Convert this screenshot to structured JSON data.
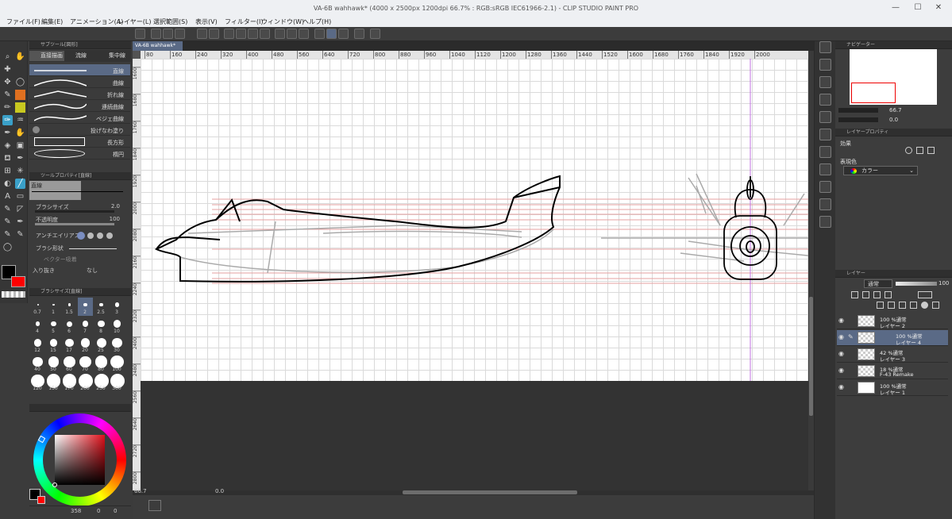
{
  "window": {
    "title": "VA-6B wahhawk* (4000 x 2500px 1200dpi 66.7% : RGB:sRGB IEC61966-2.1) - CLIP STUDIO PAINT PRO",
    "min_glyph": "—",
    "max_glyph": "☐",
    "close_glyph": "✕"
  },
  "menu": [
    "ファイル(F)",
    "編集(E)",
    "アニメーション(A)",
    "レイヤー(L)",
    "選択範囲(S)",
    "表示(V)",
    "フィルター(I)",
    "ウィンドウ(W)",
    "ヘルプ(H)"
  ],
  "document_tab": {
    "label": "VA-6B wahhawk*",
    "close": "×"
  },
  "subtool": {
    "header": "サブツール[図形]",
    "tabs": [
      "直接描画",
      "流線",
      "集中線"
    ],
    "items": [
      "直線",
      "曲線",
      "折れ線",
      "連続曲線",
      "ベジェ曲線",
      "投げなわ塗り",
      "長方形",
      "楕円"
    ]
  },
  "tool_property": {
    "header": "ツールプロパティ[直線]",
    "name": "直線",
    "brush_size_label": "ブラシサイズ",
    "brush_size_value": "2.0",
    "opacity_label": "不透明度",
    "opacity_value": "100",
    "antialias_label": "アンチエイリアス",
    "brush_shape_label": "ブラシ形状",
    "vector_label": "ベクター吸着",
    "inout_label": "入り抜き",
    "inout_value": "なし"
  },
  "brush_size": {
    "header": "ブラシサイズ[直線]",
    "sizes": [
      "0.7",
      "1",
      "1.5",
      "2",
      "2.5",
      "3",
      "4",
      "5",
      "6",
      "7",
      "8",
      "10",
      "12",
      "15",
      "17",
      "20",
      "25",
      "30",
      "40",
      "50",
      "60",
      "70",
      "80",
      "100",
      "120",
      "150",
      "170",
      "200",
      "250",
      "300"
    ],
    "selected": "2"
  },
  "color": {
    "main": "#000000",
    "sub": "#ff0000",
    "hsv_readout": [
      "358",
      "0",
      "0"
    ]
  },
  "ruler_top": [
    "80",
    "160",
    "240",
    "320",
    "400",
    "480",
    "560",
    "640",
    "720",
    "800",
    "880",
    "960",
    "1040",
    "1120",
    "1200",
    "1280",
    "1360",
    "1440",
    "1520",
    "1600",
    "1680",
    "1760",
    "1840",
    "1920",
    "2000"
  ],
  "ruler_left": [
    "1600",
    "1680",
    "1760",
    "1840",
    "1920",
    "2000",
    "2080",
    "2160",
    "2240",
    "2320",
    "2400",
    "2480",
    "2560",
    "2640",
    "2720",
    "2800"
  ],
  "status": {
    "zoom": "66.7",
    "angle": "0.0"
  },
  "navigator": {
    "header": "ナビゲーター",
    "zoom": "66.7",
    "angle": "0.0"
  },
  "layer_property": {
    "header": "レイヤープロパティ",
    "effect_label": "効果",
    "color_label": "表現色",
    "color_value": "カラー"
  },
  "layers": {
    "header": "レイヤー",
    "blend": "通常",
    "opacity": "100",
    "items": [
      {
        "line1": "100 %通常",
        "line2": "レイヤー 2"
      },
      {
        "line1": "100 %通常",
        "line2": "レイヤー 4"
      },
      {
        "line1": "42 %通常",
        "line2": "レイヤー 3"
      },
      {
        "line1": "18 %通常",
        "line2": "F-43 Remake"
      },
      {
        "line1": "100 %通常",
        "line2": "レイヤー 1"
      }
    ],
    "selected_index": 1
  }
}
